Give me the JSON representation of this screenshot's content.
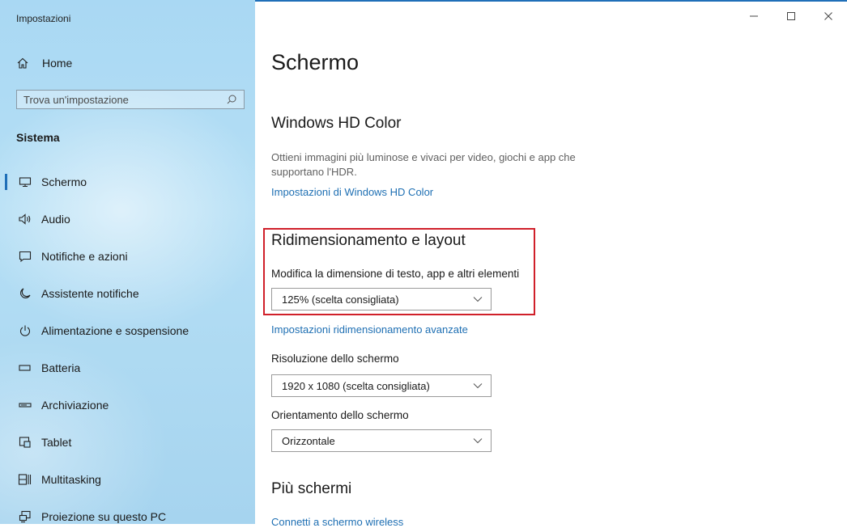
{
  "window": {
    "title": "Impostazioni",
    "controls": {
      "minimize": "–",
      "maximize": "□",
      "close": "✕"
    }
  },
  "sidebar": {
    "home_label": "Home",
    "search_placeholder": "Trova un'impostazione",
    "section_label": "Sistema",
    "items": [
      {
        "label": "Schermo",
        "icon": "monitor-icon",
        "active": true
      },
      {
        "label": "Audio",
        "icon": "speaker-icon"
      },
      {
        "label": "Notifiche e azioni",
        "icon": "message-icon"
      },
      {
        "label": "Assistente notifiche",
        "icon": "moon-icon"
      },
      {
        "label": "Alimentazione e sospensione",
        "icon": "power-icon"
      },
      {
        "label": "Batteria",
        "icon": "battery-icon"
      },
      {
        "label": "Archiviazione",
        "icon": "storage-icon"
      },
      {
        "label": "Tablet",
        "icon": "tablet-icon"
      },
      {
        "label": "Multitasking",
        "icon": "multitasking-icon"
      },
      {
        "label": "Proiezione su questo PC",
        "icon": "projection-icon"
      }
    ]
  },
  "main": {
    "page_title": "Schermo",
    "hd_color": {
      "heading": "Windows HD Color",
      "description": "Ottieni immagini più luminose e vivaci per video, giochi e app che supportano l'HDR.",
      "link": "Impostazioni di Windows HD Color"
    },
    "scale_layout": {
      "heading": "Ridimensionamento e layout",
      "scale_label": "Modifica la dimensione di testo, app e altri elementi",
      "scale_value": "125% (scelta consigliata)",
      "advanced_link": "Impostazioni ridimensionamento avanzate",
      "resolution_label": "Risoluzione dello schermo",
      "resolution_value": "1920 x 1080 (scelta consigliata)",
      "orientation_label": "Orientamento dello schermo",
      "orientation_value": "Orizzontale"
    },
    "multiple_displays": {
      "heading": "Più schermi",
      "link": "Connetti a schermo wireless"
    }
  },
  "colors": {
    "accent": "#1f6fb8",
    "link": "#1e6fb3",
    "highlight": "#d0202a"
  }
}
